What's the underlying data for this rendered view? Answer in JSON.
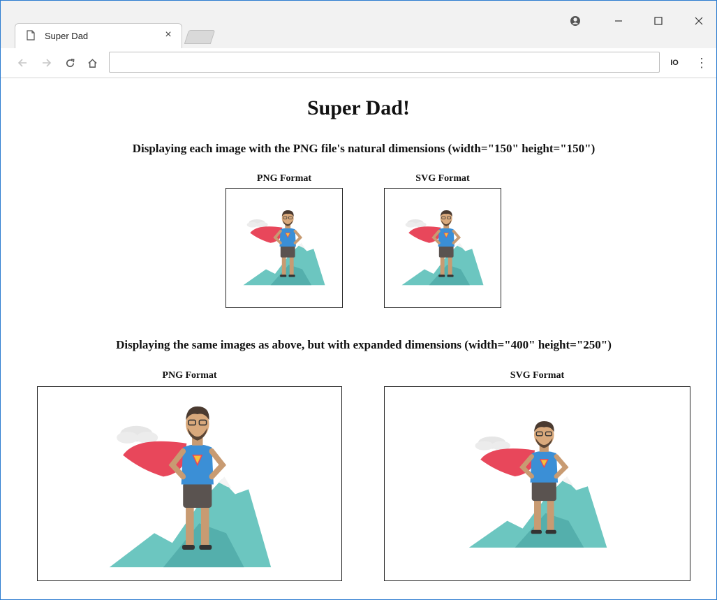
{
  "browser": {
    "tab_title": "Super Dad",
    "tab_close": "×",
    "ext_label": "IO",
    "menu": "⋮",
    "address": ""
  },
  "page": {
    "title": "Super Dad!",
    "section1": "Displaying each image with the PNG file's natural dimensions (width=\"150\" height=\"150\")",
    "section2": "Displaying the same images as above, but with expanded dimensions (width=\"400\" height=\"250\")",
    "png_caption": "PNG Format",
    "svg_caption": "SVG Format"
  },
  "colors": {
    "window_border": "#2b7bd0",
    "cape": "#e8475b",
    "shirt": "#3b8fd6",
    "mountain": "#6cc6c0",
    "mountain_dark": "#4fa9a6"
  }
}
